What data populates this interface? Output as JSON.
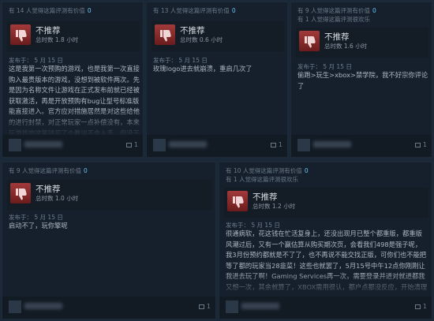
{
  "reviews": [
    {
      "helpful": "有 14 人觉得这篇评测有价值",
      "funny": "",
      "likes": "0",
      "verdict": "不推荐",
      "hours": "总时数 1.8 小时",
      "posted": "发布于：  5 月 15 日",
      "body": "这是我第一次预购的游戏，也是我第一次直接购入最贵版本的游戏，没想到被软件两次。先是因为名称文件让游戏在正式发布前就已经被获取激活，再是开放预购有bug让型号标准版能直接进入。官方应对措施居然是对这些给他的进行封禁，对正常玩家一点补偿没有，本来玩游戏的这笔钱买了个教训不会入手，但没干预",
      "comments": "1"
    },
    {
      "helpful": "有 13 人觉得这篇评测有价值",
      "funny": "",
      "likes": "0",
      "verdict": "不推荐",
      "hours": "总时数 0.6 小时",
      "posted": "发布于：  5 月 15 日",
      "body": "玫瑰logo进去就崩溃，重启几次了",
      "comments": "1"
    },
    {
      "helpful": "有 9 人觉得这篇评测有价值",
      "funny": "有 1 人觉得这篇评测很欢乐",
      "likes": "0",
      "verdict": "不推荐",
      "hours": "总时数 1.6 小时",
      "posted": "发布于：  5 月 15 日",
      "body": "偷跑>玩生>xbox>禁学院，我不好宗你评论了",
      "comments": "1"
    },
    {
      "helpful": "有 9 人觉得这篇评测有价值",
      "funny": "",
      "likes": "0",
      "verdict": "不推荐",
      "hours": "总时数 1.0 小时",
      "posted": "发布于：  5 月 15 日",
      "body": "启动不了，玩你擎呢",
      "comments": "1"
    },
    {
      "helpful": "有 10 人觉得这篇评测有价值",
      "funny": "有 1 人觉得这篇评测很欢乐",
      "likes": "0",
      "verdict": "不推荐",
      "hours": "总时数 1.2 小时",
      "posted": "发布于：  5 月 15 日",
      "body": "很通病软，花这钱在忙活复身上，还没出现月已整个都重版，都重版风潮过后，又有一个赢估算从购买期次页，会看我们498是强子呢，我3月份预约都就是不了了，也不再说不能交找正版，可你们也不能把等了都的玩家当28韭菜！这些也就罢了，5月15号中午12点你刚刚让我进去玩了啊！Gaming Services再一次，需要登录并进对就进都我又想一次，其余就算了，XBOX需用很认，都户点都没反应，开始清理启动反应，感不好分好",
      "comments": "1"
    }
  ]
}
